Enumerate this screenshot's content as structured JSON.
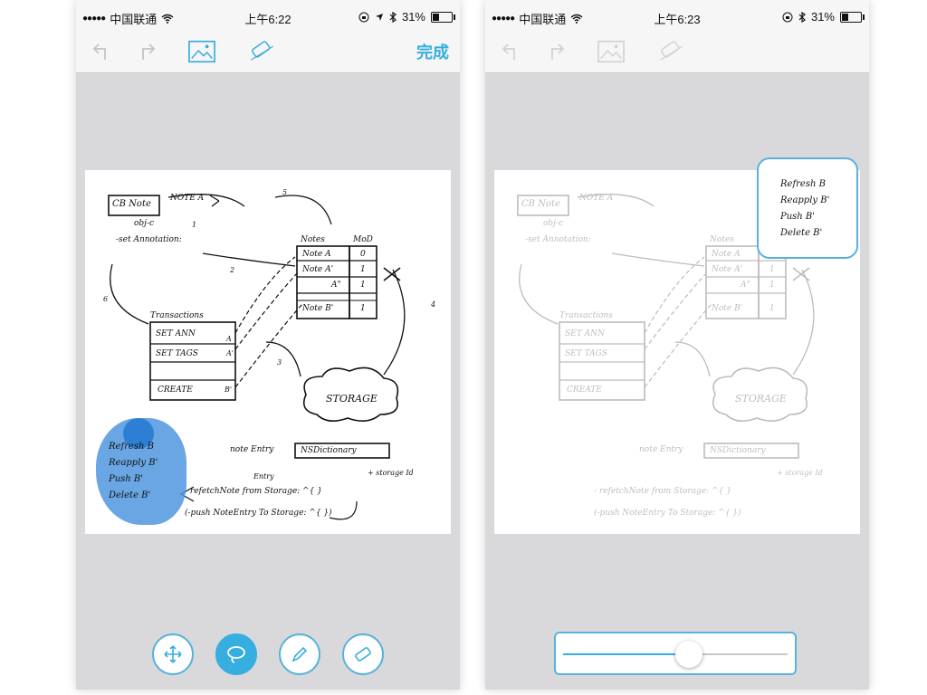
{
  "colors": {
    "accent": "#36aee0",
    "selection": "#4f96de",
    "canvas_bg": "#d9d9db"
  },
  "status_left": {
    "signal": "●●●●●",
    "carrier": "中国联通",
    "time": "上午6:22",
    "battery": "31%",
    "battery_level": 0.31
  },
  "status_right": {
    "signal": "●●●●●",
    "carrier": "中国联通",
    "time": "上午6:23",
    "battery": "31%",
    "battery_level": 0.31
  },
  "toolbar_left": {
    "done_label": "完成"
  },
  "sketch": {
    "cb_note": "CB Note",
    "note_a": "NOTE A",
    "objc": "obj-c",
    "set_annotation": "-set Annotation:",
    "notes": "Notes",
    "mod": "MoD",
    "row1": "Note A",
    "row1_val": "0",
    "row2": "Note A'",
    "row2_val": "1",
    "row3": "A\"",
    "row3_val": "1",
    "row4": "Note B'",
    "row4_val": "1",
    "transactions": "Transactions",
    "set_ann": "SET ANN",
    "set_tags": "SET TAGS",
    "create": "CREATE",
    "tag_a": "A",
    "tag_a2": "A'",
    "tag_b": "B'",
    "storage": "STORAGE",
    "note_entry": "note Entry",
    "nsdict": "NSDictionary",
    "storage_id": "+ storage Id",
    "refetch_line": "- refetchNote from Storage: ^{ }",
    "entry_word": "Entry",
    "push_line": "(-push NoteEntry To Storage: ^{ })",
    "circle1": "1",
    "circle2": "2",
    "circle3": "3",
    "circle4": "4",
    "circle5": "5",
    "circle6": "6"
  },
  "selection_note": {
    "line1": "Refresh B",
    "line2": "Reapply B'",
    "line3": "Push B'",
    "line4": "Delete B'"
  },
  "slider": {
    "value": 0.56
  },
  "tools": [
    "move-tool",
    "lasso-tool",
    "pen-tool",
    "eraser-tool"
  ]
}
